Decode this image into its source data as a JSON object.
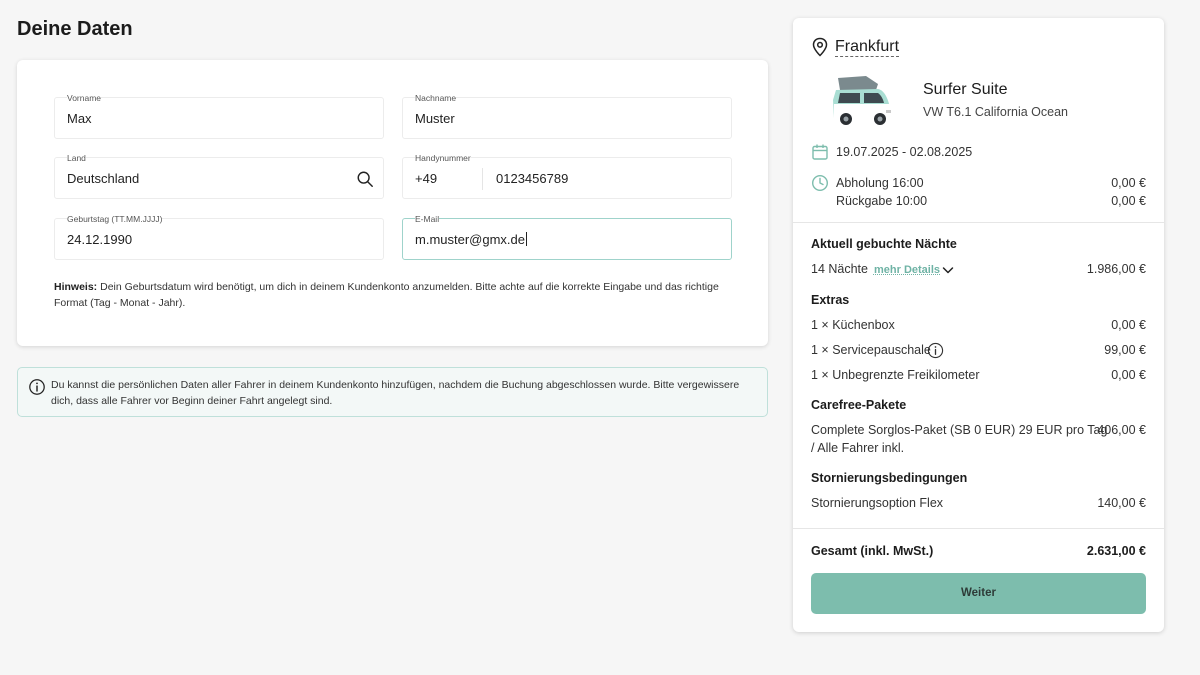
{
  "page": {
    "title": "Deine Daten"
  },
  "form": {
    "first_name": {
      "label": "Vorname",
      "value": "Max"
    },
    "last_name": {
      "label": "Nachname",
      "value": "Muster"
    },
    "country": {
      "label": "Land",
      "value": "Deutschland"
    },
    "phone": {
      "label": "Handynummer",
      "prefix": "+49",
      "value": "0123456789"
    },
    "birthday": {
      "label": "Geburtstag (TT.MM.JJJJ)",
      "value": "24.12.1990"
    },
    "email": {
      "label": "E-Mail",
      "value": "m.muster@gmx.de"
    },
    "hint_label": "Hinweis:",
    "hint_text": " Dein Geburtsdatum wird benötigt, um dich in deinem Kundenkonto anzumelden. Bitte achte auf die korrekte Eingabe und das richtige Format (Tag - Monat - Jahr)."
  },
  "info_box": {
    "text": "Du kannst die persönlichen Daten aller Fahrer in deinem Kundenkonto hinzufügen, nachdem die Buchung abgeschlossen wurde. Bitte vergewissere dich, dass alle Fahrer vor Beginn deiner Fahrt angelegt sind."
  },
  "summary": {
    "city": "Frankfurt",
    "vehicle_name": "Surfer Suite",
    "vehicle_model": "VW T6.1 California Ocean",
    "date_range": "19.07.2025 - 02.08.2025",
    "pickup": {
      "label": "Abholung 16:00",
      "amount": "0,00 €"
    },
    "return": {
      "label": "Rückgabe 10:00",
      "amount": "0,00 €"
    },
    "nights_title": "Aktuell gebuchte Nächte",
    "nights": {
      "label": "14 Nächte",
      "details_link": "mehr Details",
      "amount": "1.986,00 €"
    },
    "extras_title": "Extras",
    "extras": [
      {
        "label": "1 × Küchenbox",
        "amount": "0,00 €"
      },
      {
        "label": "1 × Servicepauschale",
        "amount": "99,00 €"
      },
      {
        "label": "1 × Unbegrenzte Freikilometer",
        "amount": "0,00 €"
      }
    ],
    "carefree_title": "Carefree-Pakete",
    "carefree": {
      "line1": "Complete Sorglos-Paket (SB 0 EUR) 29 EUR pro Tag",
      "line2": "/ Alle Fahrer inkl.",
      "amount": "406,00 €"
    },
    "cancellation_title": "Stornierungsbedingungen",
    "cancellation": {
      "label": "Stornierungsoption Flex",
      "amount": "140,00 €"
    },
    "total": {
      "label": "Gesamt (inkl. MwSt.)",
      "amount": "2.631,00 €"
    },
    "continue_label": "Weiter"
  },
  "colors": {
    "accent": "#7dbdad",
    "accent_link": "#6fb3a5",
    "info_border": "#bfe0da"
  },
  "icons": [
    "search-icon",
    "info-icon",
    "location-pin-icon",
    "calendar-icon",
    "clock-icon",
    "chevron-down-icon",
    "info-circle-icon"
  ]
}
